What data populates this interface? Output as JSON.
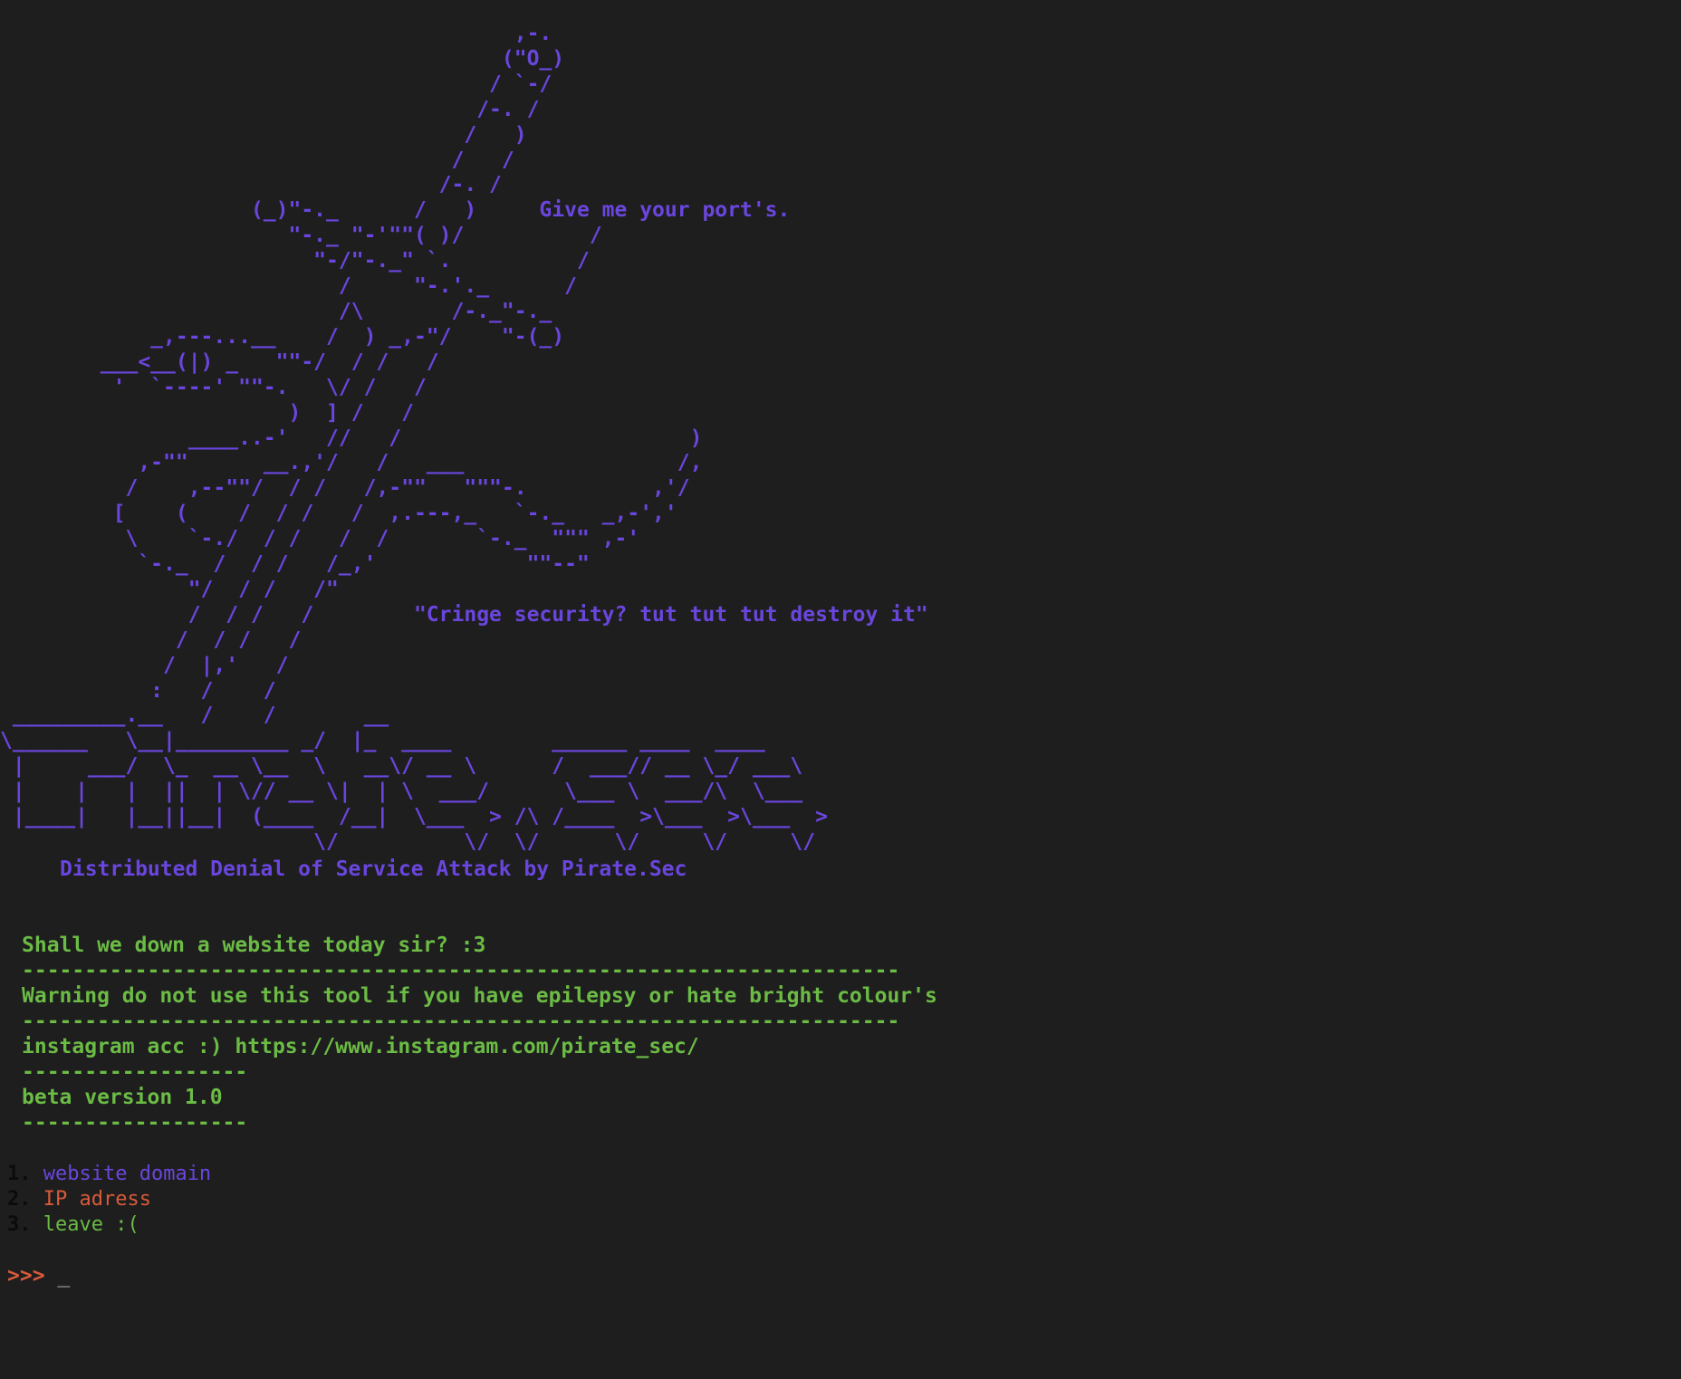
{
  "ascii_art": "                                         ,-.\n                                        (\"O_)\n                                       / `-/\n                                      /-. /\n                                     /   )\n                                    /   /\n                                   /-. /\n                    (_)\"-._      /   )     Give me your port's.\n                       \"-._ \"-'\"\"( )/          /\n                         \"-/\"-._\" `.          /\n                           /     \"-.'._      /\n                           /\\       /-._\"-._\n            _,---...__    /  ) _,-\"/    \"-(_)\n        ___<__(|) _   \"\"-/  / /   /\n         '  `----' \"\"-.   \\/ /   /\n                       )  ] /   /\n               ____..-'   //   /                       )\n           ,-\"\"      __.,'/   /   ___                 /,\n          /    ,--\"\"/  / /   /,-\"\"   \"\"\"-.          ,'/\n         [    (    /  / /   /  ,.---,_   `-._   _,-',' \n          \\    `-./  / /   /  /       `-._  \"\"\" ,-'\n           `-._  /  / /   /_,'            \"\"--\"\n               \"/  / /   /\"\n               /  / /   /        \"Cringe security? tut tut tut destroy it\"\n              /  / /   /\n             /  |,'   /\n            :   /    /\n _________.__   /    /       __\n\\______   \\__|_________ _/  |_  ____        ______ ____  ____\n |     ___/  \\_  __ \\__  \\   __\\/ __ \\      /  ___// __ \\_/ ___\\\n |    |   |  ||  | \\// __ \\|  | \\  ___/      \\___ \\  ___/\\  \\___\n |____|   |__||__|  (____  /__|  \\___  > /\\ /____  >\\___  >\\___  >\n                         \\/          \\/  \\/      \\/     \\/     \\/",
  "tagline": "Distributed Denial of Service Attack by Pirate.Sec",
  "info_lines": [
    "Shall we down a website today sir? :3",
    "----------------------------------------------------------------------",
    "Warning do not use this tool if you have epilepsy or hate bright colour's",
    "----------------------------------------------------------------------",
    "instagram acc :) https://www.instagram.com/pirate_sec/",
    "------------------",
    "beta version 1.0",
    "------------------"
  ],
  "menu": [
    {
      "num": "1.",
      "label": "website domain"
    },
    {
      "num": "2.",
      "label": "IP adress"
    },
    {
      "num": "3.",
      "label": "leave :("
    }
  ],
  "prompt": {
    "symbol": ">>>",
    "cursor": "_"
  },
  "colors": {
    "background": "#1e1e1e",
    "art": "#6a46de",
    "info": "#6bbb45",
    "accent": "#d85a3a"
  }
}
